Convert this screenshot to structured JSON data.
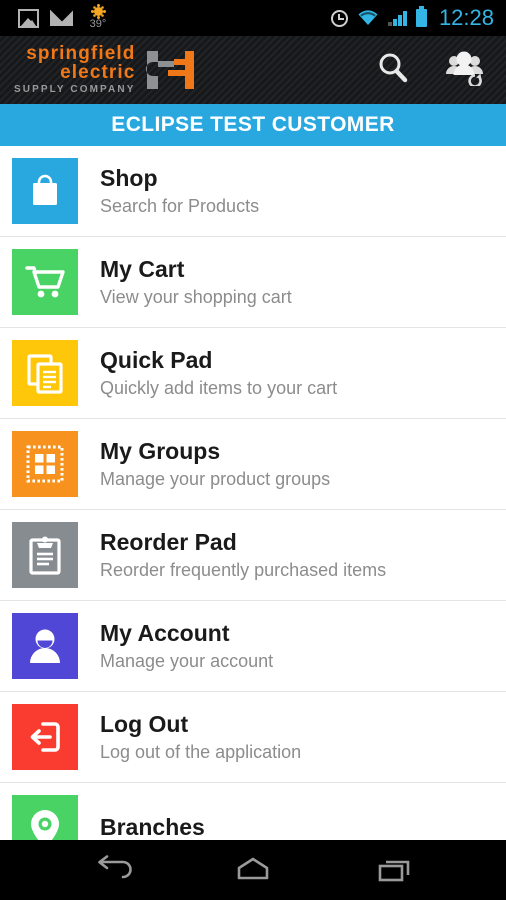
{
  "statusbar": {
    "gallery_icon": "image-icon",
    "mail_icon": "mail-icon",
    "weather_icon": "sun-icon",
    "weather_temp": "39°",
    "alarm_icon": "alarm-icon",
    "wifi_icon": "wifi-icon",
    "signal_icon": "cell-signal-icon",
    "battery_icon": "battery-icon",
    "time": "12:28",
    "accent_color": "#33b5e5"
  },
  "appbar": {
    "logo_line1": "springfield",
    "logo_line2": "electric",
    "logo_line3": "SUPPLY COMPANY",
    "logo_orange": "#f07818",
    "logo_gray": "#9a9a9a",
    "search_label": "search-icon",
    "switch_customer_label": "switch-customer-icon"
  },
  "banner": {
    "title": "ECLIPSE TEST CUSTOMER",
    "background": "#29a8e0"
  },
  "menu": {
    "items": [
      {
        "title": "Shop",
        "subtitle": "Search for Products",
        "icon": "shopping-bag-icon",
        "color": "#29a8e0"
      },
      {
        "title": "My Cart",
        "subtitle": "View your shopping cart",
        "icon": "shopping-cart-icon",
        "color": "#4ad365"
      },
      {
        "title": "Quick Pad",
        "subtitle": "Quickly add items to your cart",
        "icon": "documents-icon",
        "color": "#ffc709"
      },
      {
        "title": "My Groups",
        "subtitle": "Manage your product groups",
        "icon": "grid-groups-icon",
        "color": "#f7921e"
      },
      {
        "title": "Reorder Pad",
        "subtitle": "Reorder frequently purchased items",
        "icon": "clipboard-icon",
        "color": "#878c91"
      },
      {
        "title": "My Account",
        "subtitle": "Manage your account",
        "icon": "person-icon",
        "color": "#5147d6"
      },
      {
        "title": "Log Out",
        "subtitle": "Log out of the application",
        "icon": "exit-icon",
        "color": "#f93b30"
      },
      {
        "title": "Branches",
        "subtitle": "",
        "icon": "location-pin-icon",
        "color": "#4ad365"
      }
    ]
  },
  "navbar": {
    "back_label": "back-button",
    "home_label": "home-button",
    "recents_label": "recents-button"
  }
}
